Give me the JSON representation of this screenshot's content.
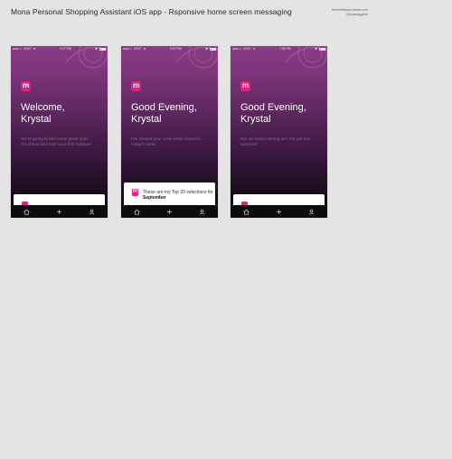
{
  "page": {
    "title": "Mona Personal Shopping Assistant iOS app - Rsponsive home screen messaging",
    "credit_line1": "thenorthtasks.tumblr.com",
    "credit_line2": "@krystalggebe"
  },
  "colors": {
    "background": "#e4e4e4",
    "accent": "#e2207e",
    "gradient_top": "#8a3c86",
    "gradient_bottom": "#120812",
    "tab_bar": "#0c0c0c"
  },
  "screens": [
    {
      "status": {
        "carrier": "AT&T",
        "time": "9:27 PM"
      },
      "logo_letter": "m",
      "greeting_line1": "Welcome,",
      "greeting_line2": "Krystal",
      "subtext": "We're going to find some great stuff. Go ahead and start your first mission!",
      "card": {
        "visible": true,
        "text": "",
        "bold": ""
      },
      "tabs": [
        "home-icon",
        "plus-icon",
        "profile-icon"
      ]
    },
    {
      "status": {
        "carrier": "AT&T",
        "time": "6:57 PM"
      },
      "logo_letter": "m",
      "greeting_line1": "Good Evening,",
      "greeting_line2": "Krystal",
      "subtext": "I've missed you! Look what I found in today's cards",
      "card": {
        "visible": true,
        "text": "These are my Top 20 selections for",
        "bold": "September"
      },
      "tabs": [
        "home-icon",
        "plus-icon",
        "profile-icon"
      ]
    },
    {
      "status": {
        "carrier": "AT&T",
        "time": "7:55 PM"
      },
      "logo_letter": "m",
      "greeting_line1": "Good Evening,",
      "greeting_line2": "Krystal",
      "subtext": "Got an event coming up? I've got you covered!",
      "card": {
        "visible": true,
        "text": "",
        "bold": ""
      },
      "tabs": [
        "home-icon",
        "plus-icon",
        "profile-icon"
      ]
    }
  ]
}
